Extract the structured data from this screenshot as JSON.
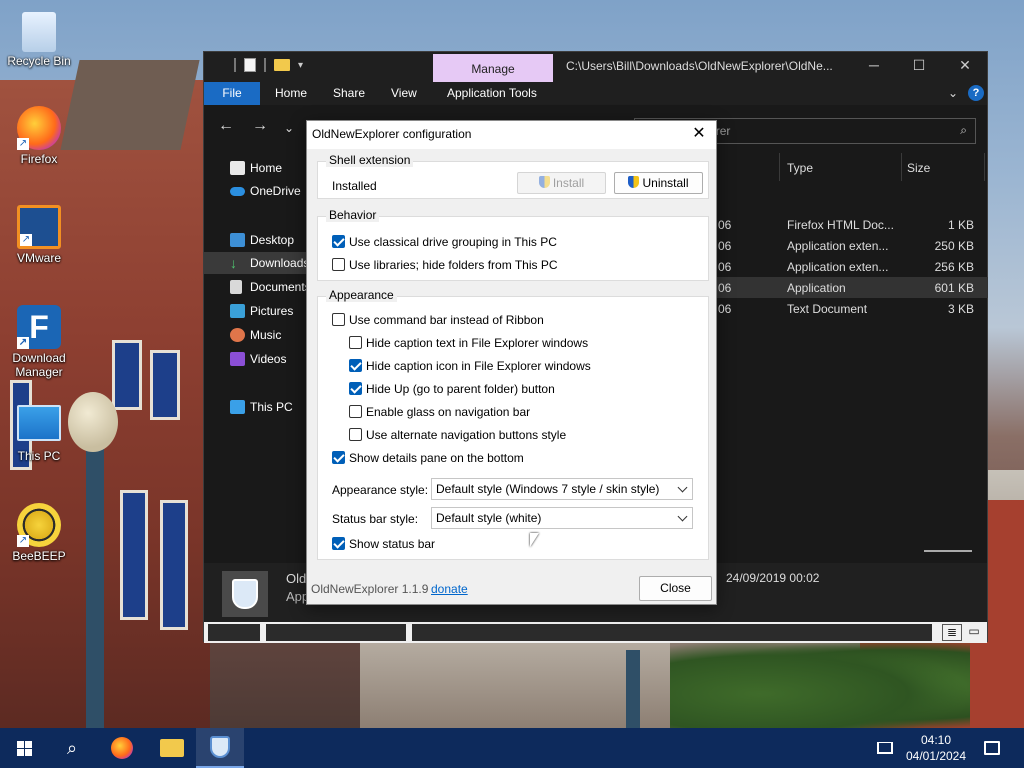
{
  "desktop": {
    "icons": [
      {
        "label": "Recycle Bin"
      },
      {
        "label": "Firefox"
      },
      {
        "label": "VMware"
      },
      {
        "label": "Download Manager"
      },
      {
        "label": "This PC"
      },
      {
        "label": "BeeBEEP"
      }
    ]
  },
  "explorer": {
    "contextual_tab": "Manage",
    "path": "C:\\Users\\Bill\\Downloads\\OldNewExplorer\\OldNe...",
    "ribbon_tabs": [
      "File",
      "Home",
      "Share",
      "View",
      "Application Tools"
    ],
    "search_placeholder": "OldNewExplorer",
    "sidebar": [
      "Home",
      "OneDrive",
      "Desktop",
      "Downloads",
      "Documents",
      "Pictures",
      "Music",
      "Videos",
      "This PC"
    ],
    "columns": {
      "type": "Type",
      "size": "Size"
    },
    "files": [
      {
        "date_tail": "06",
        "type": "Firefox HTML Doc...",
        "size": "1 KB"
      },
      {
        "date_tail": "06",
        "type": "Application exten...",
        "size": "250 KB"
      },
      {
        "date_tail": "06",
        "type": "Application exten...",
        "size": "256 KB"
      },
      {
        "date_tail": "06",
        "type": "Application",
        "size": "601 KB"
      },
      {
        "date_tail": "06",
        "type": "Text Document",
        "size": "3 KB"
      }
    ],
    "details": {
      "name": "Old",
      "sub": "App",
      "date": "24/09/2019 00:02"
    }
  },
  "dialog": {
    "title": "OldNewExplorer configuration",
    "shell": {
      "legend": "Shell extension",
      "status": "Installed",
      "install_label": "Install",
      "uninstall_label": "Uninstall"
    },
    "behavior": {
      "legend": "Behavior",
      "options": [
        {
          "label": "Use classical drive grouping in This PC",
          "checked": true
        },
        {
          "label": "Use libraries; hide folders from This PC",
          "checked": false
        }
      ]
    },
    "appearance": {
      "legend": "Appearance",
      "options": [
        {
          "label": "Use command bar instead of Ribbon",
          "checked": false
        },
        {
          "label": "Hide caption text in File Explorer windows",
          "checked": false
        },
        {
          "label": "Hide caption icon in File Explorer windows",
          "checked": true
        },
        {
          "label": "Hide Up (go to parent folder) button",
          "checked": true
        },
        {
          "label": "Enable glass on navigation bar",
          "checked": false
        },
        {
          "label": "Use alternate navigation buttons style",
          "checked": false
        },
        {
          "label": "Show details pane on the bottom",
          "checked": true
        }
      ],
      "style_label": "Appearance style:",
      "style_value": "Default style (Windows 7 style / skin style)",
      "statusbar_label": "Status bar style:",
      "statusbar_value": "Default style (white)",
      "show_statusbar": {
        "label": "Show status bar",
        "checked": true
      }
    },
    "footer": {
      "version": "OldNewExplorer 1.1.9",
      "donate": "donate",
      "close_label": "Close"
    }
  },
  "taskbar": {
    "time": "04:10",
    "date": "04/01/2024"
  }
}
